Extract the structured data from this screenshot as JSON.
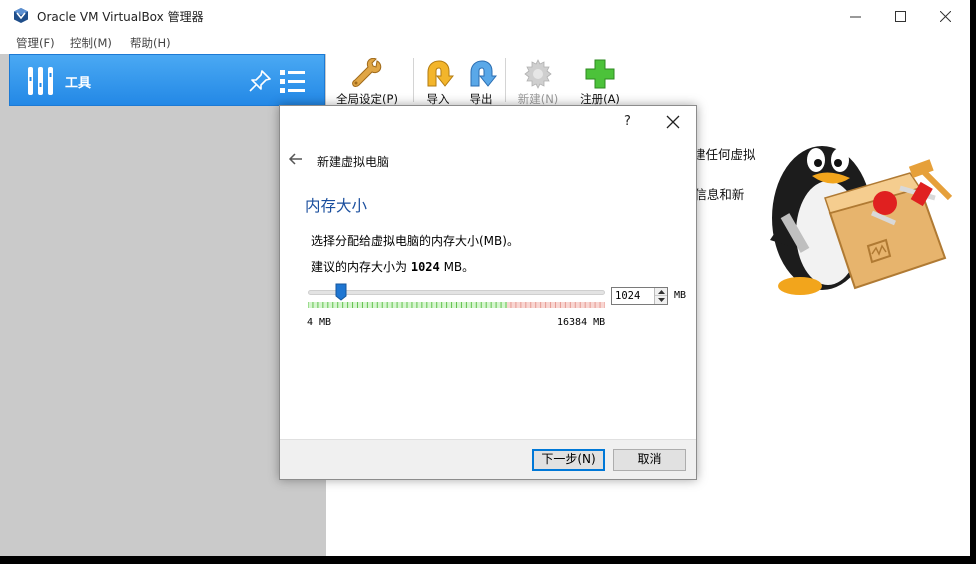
{
  "window": {
    "title": "Oracle VM VirtualBox 管理器",
    "controls": {
      "minimize": "—",
      "maximize": "☐",
      "close": "✕"
    }
  },
  "menu": [
    "管理(F)",
    "控制(M)",
    "帮助(H)"
  ],
  "tools_header": {
    "label": "工具",
    "pin_icon": "pin-icon",
    "menu_icon": "list-menu-icon",
    "accent": "#2a8ee8"
  },
  "toolbar": [
    {
      "label": "全局设定(P)",
      "icon": "wrench-icon",
      "enabled": true
    },
    {
      "label": "导入",
      "icon": "import-arrow-icon",
      "enabled": true
    },
    {
      "label": "导出",
      "icon": "export-arrow-icon",
      "enabled": true
    },
    {
      "label": "新建(N)",
      "icon": "gear-new-icon",
      "enabled": false
    },
    {
      "label": "注册(A)",
      "icon": "plus-icon",
      "enabled": true
    }
  ],
  "welcome_fragments": [
    "建任何虚拟",
    "f信息和新"
  ],
  "dialog": {
    "help": "?",
    "close": "✕",
    "wizard_title": "新建虚拟电脑",
    "heading": "内存大小",
    "description": "选择分配给虚拟电脑的内存大小(MB)。",
    "recommend_prefix": "建议的内存大小为",
    "recommend_value": "1024",
    "recommend_suffix": "MB。",
    "slider": {
      "min_label": "4 MB",
      "max_label": "16384 MB",
      "value": 1024,
      "min": 4,
      "max": 16384
    },
    "spin_value": "1024",
    "unit": "MB",
    "next_button": "下一步(N)",
    "cancel_button": "取消"
  }
}
